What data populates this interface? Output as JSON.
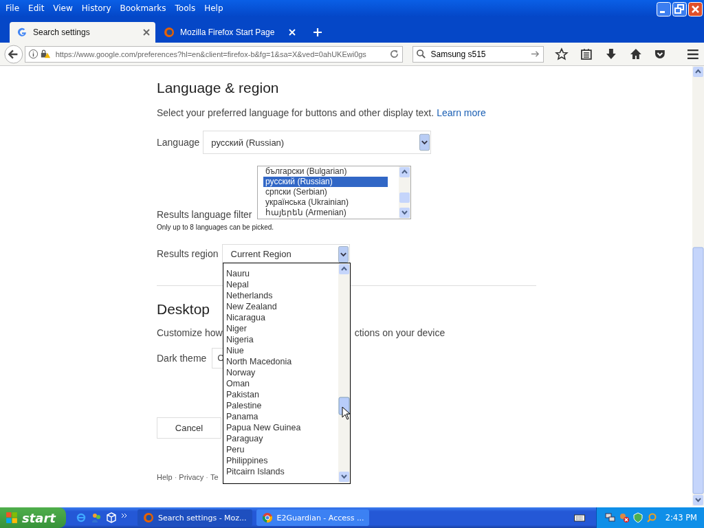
{
  "menu": [
    "File",
    "Edit",
    "View",
    "History",
    "Bookmarks",
    "Tools",
    "Help"
  ],
  "tabs": [
    {
      "label": "Search settings",
      "selected": true
    },
    {
      "label": "Mozilla Firefox Start Page",
      "selected": false
    }
  ],
  "navbar": {
    "url": "https://www.google.com/preferences?hl=en&client=firefox-b&fg=1&sa=X&ved=0ahUKEwi0gs",
    "search": "Samsung s515"
  },
  "page": {
    "heading": "Language & region",
    "description": "Select your preferred language for buttons and other display text.",
    "learn_more": "Learn more",
    "language": {
      "label": "Language",
      "value": "русский (Russian)"
    },
    "language_list": [
      {
        "label": "български (Bulgarian)",
        "selected": false
      },
      {
        "label": "русский (Russian)",
        "selected": true
      },
      {
        "label": "српски (Serbian)",
        "selected": false
      },
      {
        "label": "українська (Ukrainian)",
        "selected": false
      },
      {
        "label": "հայերեն (Armenian)",
        "selected": false
      }
    ],
    "filter_label": "Results language filter",
    "filter_note": "Only up to 8 languages can be picked.",
    "region": {
      "label": "Results region",
      "value": "Current Region"
    },
    "region_list": [
      {
        "label": "Nauru",
        "selected": false
      },
      {
        "label": "Nepal",
        "selected": false
      },
      {
        "label": "Netherlands",
        "selected": false
      },
      {
        "label": "New Zealand",
        "selected": false
      },
      {
        "label": "Nicaragua",
        "selected": false
      },
      {
        "label": "Niger",
        "selected": false
      },
      {
        "label": "Nigeria",
        "selected": false
      },
      {
        "label": "Niue",
        "selected": false
      },
      {
        "label": "North Macedonia",
        "selected": false
      },
      {
        "label": "Norway",
        "selected": false
      },
      {
        "label": "Oman",
        "selected": false
      },
      {
        "label": "Pakistan",
        "selected": false
      },
      {
        "label": "Palestine",
        "selected": false
      },
      {
        "label": "Panama",
        "selected": false
      },
      {
        "label": "Papua New Guinea",
        "selected": false
      },
      {
        "label": "Paraguay",
        "selected": false
      },
      {
        "label": "Peru",
        "selected": false
      },
      {
        "label": "Philippines",
        "selected": false
      },
      {
        "label": "Pitcairn Islands",
        "selected": false
      }
    ],
    "desktop_heading": "Desktop",
    "customize_start": "Customize how",
    "customize_end": "ctions on your device",
    "dark_theme": {
      "label": "Dark theme",
      "value": "C"
    },
    "cancel": "Cancel",
    "footer": [
      {
        "kind": "link",
        "text": "Help"
      },
      {
        "kind": "sep",
        "text": "·"
      },
      {
        "kind": "link",
        "text": "Privacy"
      },
      {
        "kind": "sep",
        "text": "·"
      },
      {
        "kind": "link",
        "text": "Te"
      }
    ]
  },
  "taskbar": {
    "start": "start",
    "tasks": [
      {
        "label": "Search settings - Moz...",
        "selected": true
      },
      {
        "label": "E2Guardian - Access ...",
        "selected": false
      }
    ],
    "clock": "2:43 PM"
  }
}
